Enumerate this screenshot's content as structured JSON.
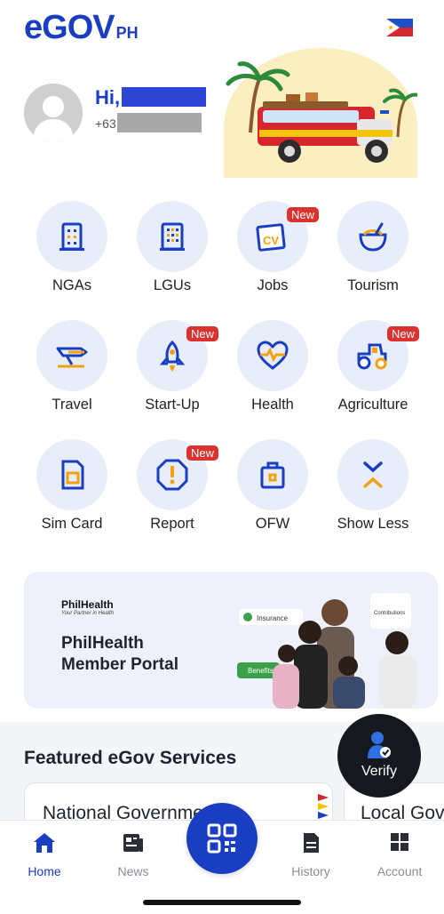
{
  "header": {
    "logo_e": "e",
    "logo_gov": "GOV",
    "logo_ph": "PH"
  },
  "profile": {
    "greeting": "Hi,",
    "phone_prefix": "+63"
  },
  "services": [
    {
      "label": "NGAs",
      "icon": "building-icon",
      "badge": ""
    },
    {
      "label": "LGUs",
      "icon": "office-building-icon",
      "badge": ""
    },
    {
      "label": "Jobs",
      "icon": "cv-icon",
      "badge": "New"
    },
    {
      "label": "Tourism",
      "icon": "coconut-drink-icon",
      "badge": ""
    },
    {
      "label": "Travel",
      "icon": "airplane-icon",
      "badge": ""
    },
    {
      "label": "Start-Up",
      "icon": "rocket-icon",
      "badge": "New"
    },
    {
      "label": "Health",
      "icon": "heart-pulse-icon",
      "badge": ""
    },
    {
      "label": "Agriculture",
      "icon": "tractor-icon",
      "badge": "New"
    },
    {
      "label": "Sim Card",
      "icon": "sim-card-icon",
      "badge": ""
    },
    {
      "label": "Report",
      "icon": "alert-octagon-icon",
      "badge": "New"
    },
    {
      "label": "OFW",
      "icon": "briefcase-icon",
      "badge": ""
    },
    {
      "label": "Show Less",
      "icon": "collapse-icon",
      "badge": ""
    }
  ],
  "banner": {
    "brand": "PhilHealth",
    "brand_tagline": "Your Partner in Health",
    "title_line1": "PhilHealth",
    "title_line2": "Member Portal",
    "chip_insurance": "Insurance",
    "chip_contributions": "Contributions",
    "chip_benefits": "Benefits"
  },
  "featured": {
    "title": "Featured eGov Services",
    "cards": [
      "National Government",
      "Local Government"
    ]
  },
  "verify": {
    "label": "Verify"
  },
  "nav": {
    "home": "Home",
    "news": "News",
    "history": "History",
    "account": "Account"
  },
  "colors": {
    "primary": "#1a3ec1",
    "badge": "#d9322f",
    "icon_bg": "#e8edfa",
    "accent_orange": "#f2a20c"
  }
}
